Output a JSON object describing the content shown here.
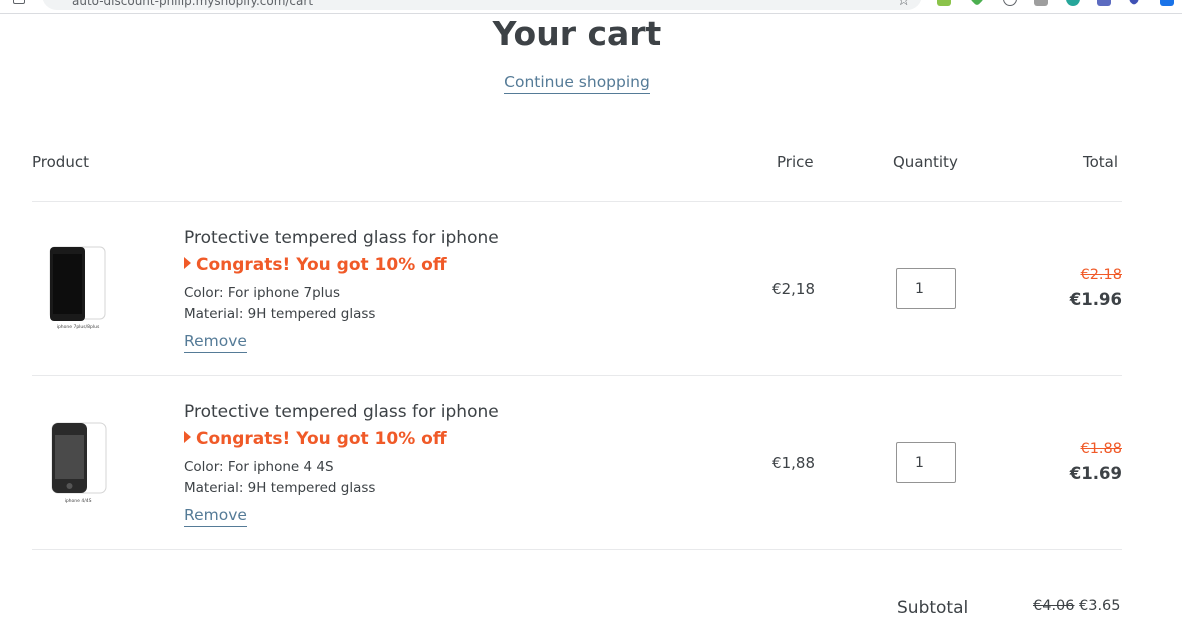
{
  "browser": {
    "url": "auto-discount-philip.myshopify.com/cart"
  },
  "page": {
    "title": "Your cart",
    "continue_label": "Continue shopping"
  },
  "table": {
    "headers": {
      "product": "Product",
      "price": "Price",
      "quantity": "Quantity",
      "total": "Total"
    }
  },
  "items": [
    {
      "name": "Protective tempered glass for iphone",
      "promo": "Congrats! You got 10% off",
      "color": "Color: For iphone 7plus",
      "material": "Material: 9H tempered glass",
      "remove_label": "Remove",
      "price": "€2,18",
      "quantity": "1",
      "original_total": "€2.18",
      "discounted_total": "€1.96",
      "image_caption": "iphone 7plus/8plus"
    },
    {
      "name": "Protective tempered glass for iphone",
      "promo": "Congrats! You got 10% off",
      "color": "Color: For iphone 4 4S",
      "material": "Material: 9H tempered glass",
      "remove_label": "Remove",
      "price": "€1,88",
      "quantity": "1",
      "original_total": "€1.88",
      "discounted_total": "€1.69",
      "image_caption": "iphone 4/4S"
    }
  ],
  "summary": {
    "subtotal_label": "Subtotal",
    "original_subtotal": "€4.06",
    "discounted_subtotal": "€3.65"
  },
  "colors": {
    "accent_orange": "#f05a28",
    "link_blue": "#557b97",
    "text": "#3d4246"
  }
}
